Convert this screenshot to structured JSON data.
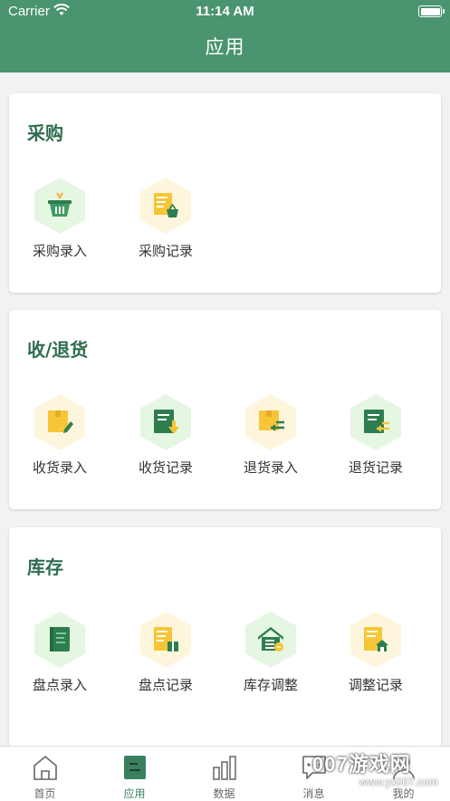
{
  "status_bar": {
    "carrier": "Carrier",
    "time": "11:14 AM"
  },
  "nav": {
    "title": "应用"
  },
  "sections": [
    {
      "title": "采购",
      "items": [
        {
          "label": "采购录入",
          "icon": "basket-icon"
        },
        {
          "label": "采购记录",
          "icon": "purchase-record-icon"
        }
      ]
    },
    {
      "title": "收/退货",
      "items": [
        {
          "label": "收货录入",
          "icon": "receive-entry-icon"
        },
        {
          "label": "收货记录",
          "icon": "receive-record-icon"
        },
        {
          "label": "退货录入",
          "icon": "return-entry-icon"
        },
        {
          "label": "退货记录",
          "icon": "return-record-icon"
        }
      ]
    },
    {
      "title": "库存",
      "items": [
        {
          "label": "盘点录入",
          "icon": "stocktake-entry-icon"
        },
        {
          "label": "盘点记录",
          "icon": "stocktake-record-icon"
        },
        {
          "label": "库存调整",
          "icon": "warehouse-adjust-icon"
        },
        {
          "label": "调整记录",
          "icon": "adjust-record-icon"
        }
      ]
    }
  ],
  "tabbar": {
    "items": [
      {
        "label": "首页",
        "icon": "home-icon"
      },
      {
        "label": "应用",
        "icon": "apps-icon",
        "active": true
      },
      {
        "label": "数据",
        "icon": "bar-chart-icon"
      },
      {
        "label": "消息",
        "icon": "message-icon"
      },
      {
        "label": "我的",
        "icon": "profile-icon"
      }
    ]
  },
  "watermark": {
    "main": "007游戏网",
    "sub": "www.yx007.com"
  },
  "colors": {
    "header": "#4a9470",
    "section_title": "#2f6e4e",
    "green_dark": "#2f7d4f",
    "yellow": "#f6c638"
  }
}
